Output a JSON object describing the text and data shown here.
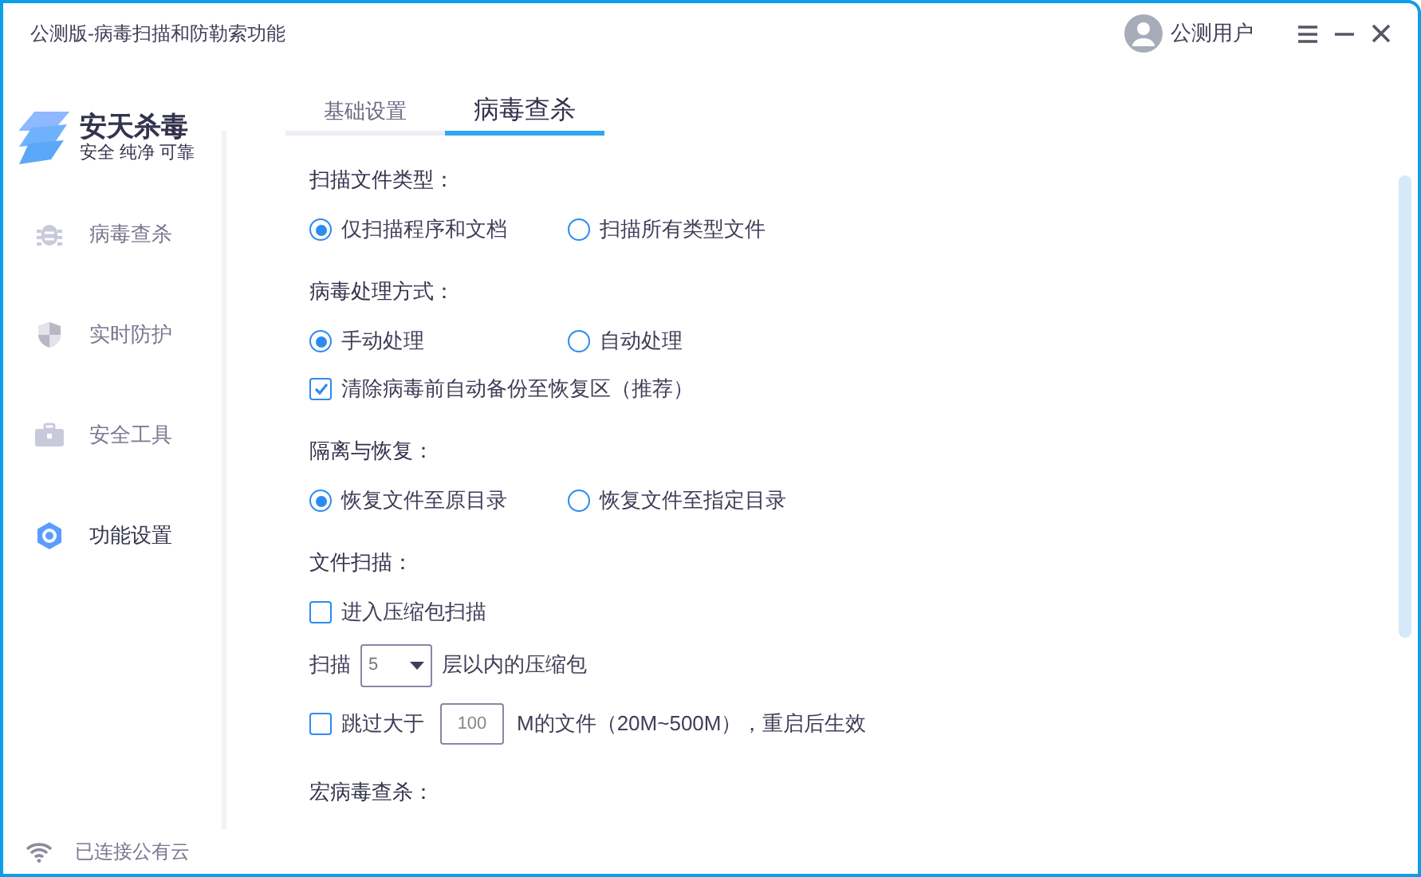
{
  "window": {
    "title": "公测版-病毒扫描和防勒索功能"
  },
  "user": {
    "name": "公测用户"
  },
  "logo": {
    "name": "安天杀毒",
    "slogan": "安全 纯净 可靠"
  },
  "sidebar": {
    "items": [
      {
        "label": "病毒查杀",
        "selected": false
      },
      {
        "label": "实时防护",
        "selected": false
      },
      {
        "label": "安全工具",
        "selected": false
      },
      {
        "label": "功能设置",
        "selected": true
      }
    ]
  },
  "tabs": [
    {
      "label": "基础设置",
      "selected": false
    },
    {
      "label": "病毒查杀",
      "selected": true
    }
  ],
  "sections": [
    {
      "title": "扫描文件类型：",
      "rows": [
        {
          "kind": "radio_group",
          "options": [
            {
              "label": "仅扫描程序和文档",
              "selected": true
            },
            {
              "label": "扫描所有类型文件",
              "selected": false
            }
          ]
        }
      ]
    },
    {
      "title": "病毒处理方式：",
      "rows": [
        {
          "kind": "radio_group",
          "options": [
            {
              "label": "手动处理",
              "selected": true
            },
            {
              "label": "自动处理",
              "selected": false
            }
          ]
        },
        {
          "kind": "checkbox",
          "label": "清除病毒前自动备份至恢复区（推荐）",
          "checked": true
        }
      ]
    },
    {
      "title": "隔离与恢复：",
      "rows": [
        {
          "kind": "radio_group",
          "options": [
            {
              "label": "恢复文件至原目录",
              "selected": true
            },
            {
              "label": "恢复文件至指定目录",
              "selected": false
            }
          ]
        }
      ]
    },
    {
      "title": "文件扫描：",
      "rows": [
        {
          "kind": "checkbox",
          "label": "进入压缩包扫描",
          "checked": false
        },
        {
          "kind": "select_row",
          "prefix": "扫描",
          "value": "5",
          "suffix": "层以内的压缩包"
        },
        {
          "kind": "input_row",
          "checked": false,
          "prefix": "跳过大于",
          "value": "100",
          "suffix": "M的文件（20M~500M），重启后生效"
        }
      ]
    },
    {
      "title": "宏病毒查杀："
    }
  ],
  "status_bar": {
    "text": "已连接公有云"
  }
}
